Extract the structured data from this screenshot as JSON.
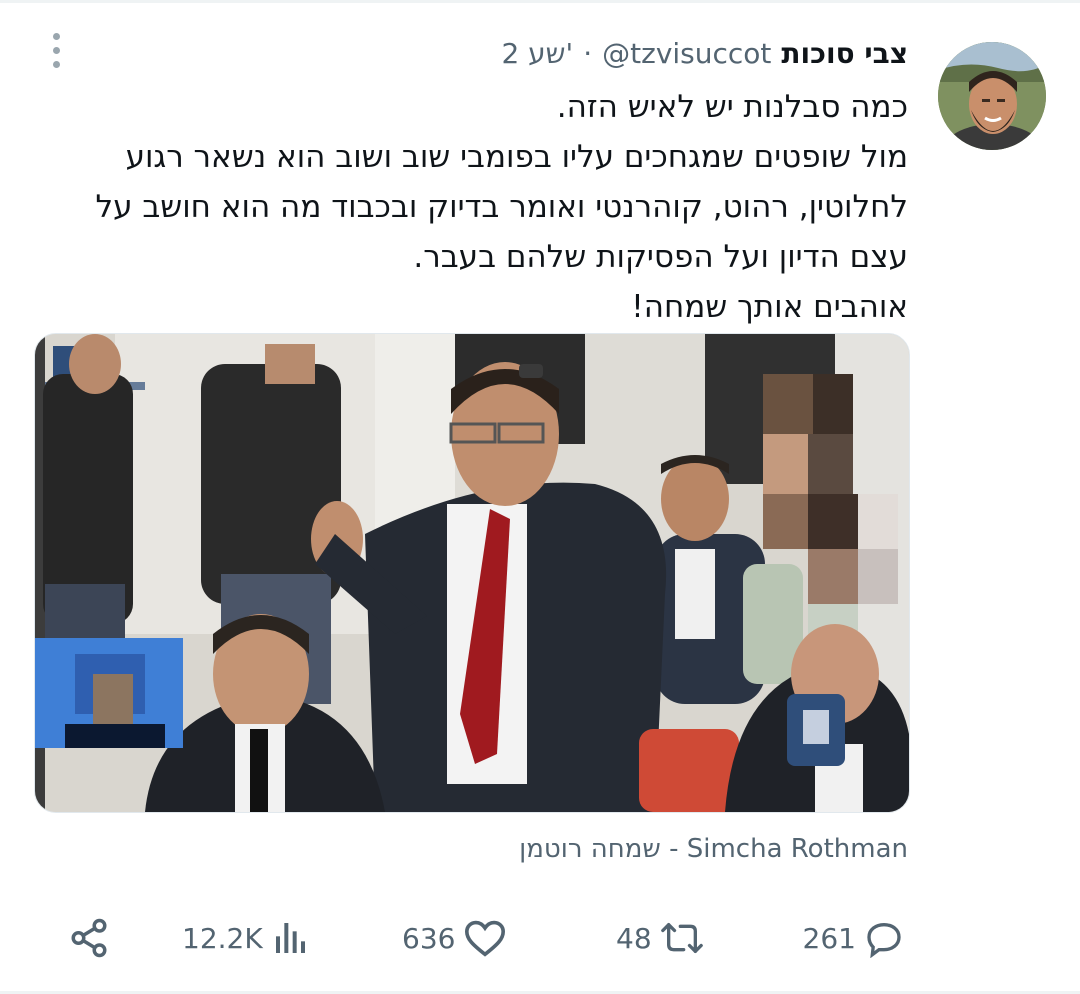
{
  "author": {
    "name": "צבי סוכות",
    "handle": "@tzvisuccot",
    "separator": "·",
    "time": "2 שע'"
  },
  "tweet": {
    "lines": [
      "כמה סבלנות יש לאיש הזה.",
      "מול שופטים שמגחכים עליו בפומבי שוב ושוב הוא נשאר רגוע",
      "לחלוטין, רהוט, קוהרנטי ואומר בדיוק ובכבוד מה הוא חושב על",
      "עצם הדיון ועל הפסיקות שלהם בעבר.",
      "אוהבים אותך שמחה!"
    ]
  },
  "media": {
    "caption": "שמחה רוטמן - Simcha Rothman"
  },
  "actions": {
    "replies": "261",
    "retweets": "48",
    "likes": "636",
    "views": "12.2K"
  },
  "colors": {
    "text": "#0f1419",
    "secondary": "#536471",
    "divider": "#eff3f4"
  },
  "icons": {
    "more": "more-vertical-icon",
    "reply": "reply-icon",
    "retweet": "retweet-icon",
    "like": "heart-icon",
    "views": "views-chart-icon",
    "share": "share-icon"
  }
}
